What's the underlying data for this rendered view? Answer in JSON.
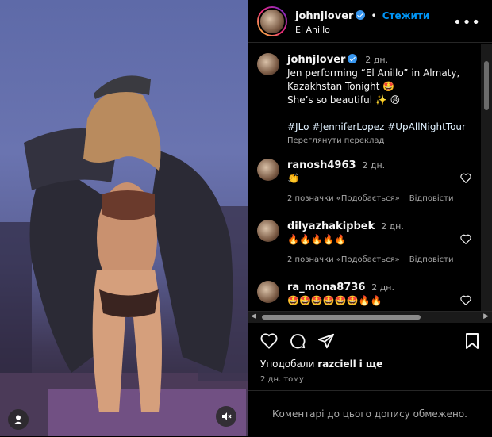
{
  "media": {
    "description_icon": "person-icon",
    "mute_icon": "speaker-muted-icon"
  },
  "header": {
    "username": "johnjlover",
    "separator": "•",
    "follow_label": "Стежити",
    "subtitle": "El Anillo",
    "more_icon": "ellipsis-icon"
  },
  "caption": {
    "username": "johnjlover",
    "time": "2 дн.",
    "line1": "Jen performing “El Anillo” in Almaty,",
    "line2": "Kazakhstan Tonight 🤩",
    "line3": "She’s so beautiful ✨ 😩",
    "hashtags": "#JLo #JenniferLopez #UpAllNightTour",
    "translate": "Переглянути переклад"
  },
  "comments": [
    {
      "username": "ranosh4963",
      "time": "2 дн.",
      "text": "👏",
      "likes": "2 позначки «Подобається»",
      "reply": "Відповісти"
    },
    {
      "username": "dilyazhakipbek",
      "time": "2 дн.",
      "text": "🔥🔥🔥🔥🔥",
      "likes": "2 позначки «Подобається»",
      "reply": "Відповісти"
    },
    {
      "username": "ra_mona8736",
      "time": "2 дн.",
      "text": "🤩🤩🤩🤩🤩🤩🔥🔥",
      "likes": "",
      "reply": ""
    }
  ],
  "likes_text": {
    "prefix": "Уподобали",
    "user": "razciell",
    "suffix": "і ще"
  },
  "date": "2 дн. тому",
  "restricted": "Коментарі до цього допису обмежено.",
  "colors": {
    "accent": "#0095f6",
    "verified": "#3897f0",
    "bg": "#000000",
    "muted": "#a8a8a8"
  }
}
